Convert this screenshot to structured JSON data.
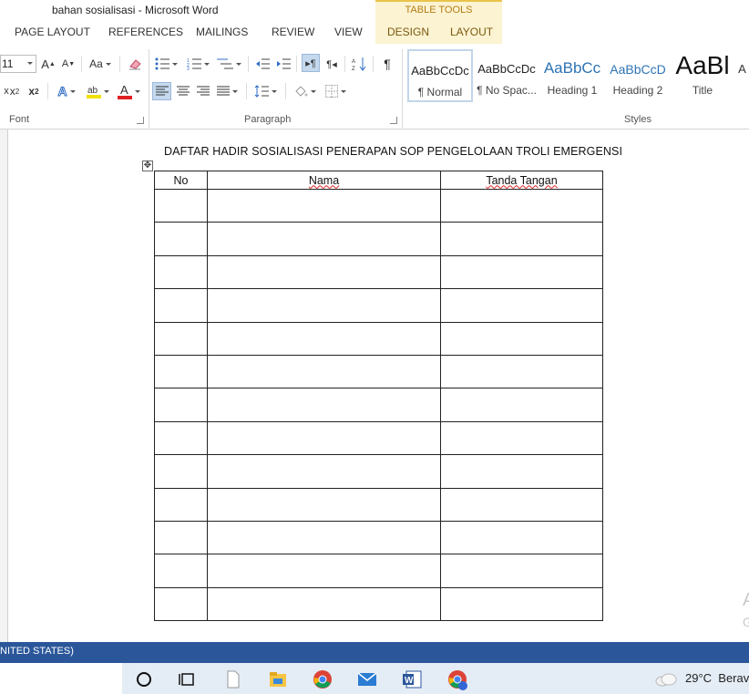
{
  "window": {
    "title": "bahan sosialisasi - Microsoft Word",
    "context_group": "TABLE TOOLS"
  },
  "tabs": [
    {
      "label": "PAGE LAYOUT"
    },
    {
      "label": "REFERENCES"
    },
    {
      "label": "MAILINGS"
    },
    {
      "label": "REVIEW"
    },
    {
      "label": "VIEW"
    },
    {
      "label": "DESIGN"
    },
    {
      "label": "LAYOUT"
    }
  ],
  "ribbon": {
    "font_size": "11",
    "change_case": "Aa",
    "font_group_label": "Font",
    "paragraph_group_label": "Paragraph",
    "styles_group_label": "Styles",
    "styles": [
      {
        "preview": "AaBbCcDc",
        "name": "¶ Normal"
      },
      {
        "preview": "AaBbCcDc",
        "name": "¶ No Spac..."
      },
      {
        "preview": "AaBbCc",
        "name": "Heading 1"
      },
      {
        "preview": "AaBbCcD",
        "name": "Heading 2"
      },
      {
        "preview": "AaBl",
        "name": "Title"
      },
      {
        "preview": "A",
        "name": ""
      }
    ],
    "colors": {
      "highlight": "#f2e000",
      "font_color": "#e02020"
    }
  },
  "document": {
    "heading": "DAFTAR HADIR SOSIALISASI PENERAPAN SOP PENGELOLAAN TROLI EMERGENSI",
    "table": {
      "headers": [
        "No",
        "Nama",
        "Tanda Tangan"
      ],
      "empty_rows": 13
    },
    "watermark_partial": "A",
    "watermark_partial_2": "G"
  },
  "status": {
    "text": "NITED STATES)"
  },
  "taskbar": {
    "icons": [
      "cortana-icon",
      "task-view-icon",
      "file-icon",
      "file-explorer-icon",
      "chrome-icon",
      "mail-icon",
      "word-icon",
      "chrome-profile-icon"
    ],
    "weather_temp": "29°C",
    "weather_desc": "Berav"
  }
}
